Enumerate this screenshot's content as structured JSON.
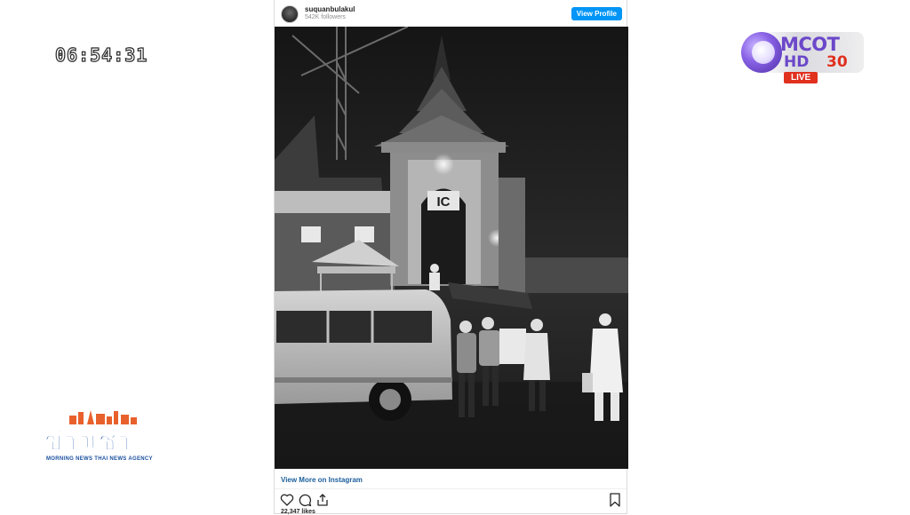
{
  "clock": "06:54:31",
  "channel_logo": {
    "word": "MCOT",
    "hd": "HD",
    "channel_number": "30",
    "live": "LIVE",
    "colors": {
      "purple": "#6b47c9",
      "red": "#e0301e"
    }
  },
  "instagram": {
    "username": "suquanbulakul",
    "followers": "542K followers",
    "view_profile_label": "View Profile",
    "view_more_label": "View More on Instagram",
    "likes": "22,347 likes",
    "icons": [
      "heart-icon",
      "comment-icon",
      "share-icon",
      "bookmark-icon"
    ],
    "accent": "#0095f6"
  },
  "photo": {
    "sign_text": "IC"
  },
  "news_logo": {
    "title": "ข่าวเช้า",
    "subtitle": "MORNING NEWS THAI NEWS AGENCY"
  }
}
